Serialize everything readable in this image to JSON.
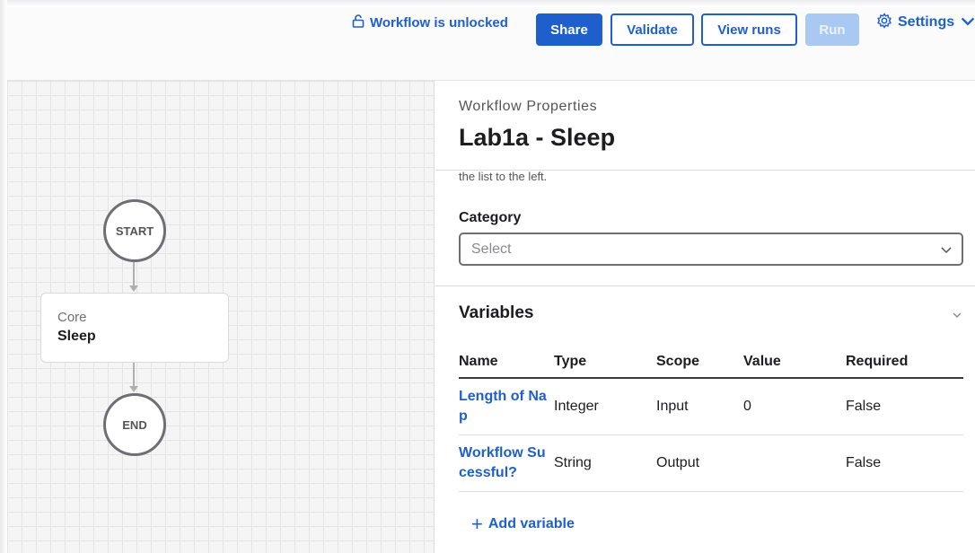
{
  "toolbar": {
    "lock_status": "Workflow is unlocked",
    "share_label": "Share",
    "validate_label": "Validate",
    "view_runs_label": "View runs",
    "run_label": "Run",
    "settings_label": "Settings",
    "icons": {
      "lock": "lock-open-icon",
      "settings": "gear-icon",
      "settings_dropdown": "chevron-down-icon"
    },
    "colors": {
      "accent": "#1f5fcc",
      "run_disabled": "#a9c8f2"
    }
  },
  "canvas": {
    "start_label": "START",
    "end_label": "END",
    "activity": {
      "category": "Core",
      "name": "Sleep"
    }
  },
  "panel": {
    "subtitle": "Workflow Properties",
    "title": "Lab1a - Sleep",
    "description_tail": "the list to the left.",
    "category_label": "Category",
    "category_placeholder": "Select",
    "variables_heading": "Variables",
    "variables": {
      "columns": [
        "Name",
        "Type",
        "Scope",
        "Value",
        "Required"
      ],
      "rows": [
        {
          "name": "Length of Nap",
          "type": "Integer",
          "scope": "Input",
          "value": "0",
          "required": "False"
        },
        {
          "name": "Workflow Sucessful?",
          "type": "String",
          "scope": "Output",
          "value": "",
          "required": "False"
        }
      ]
    },
    "add_variable_label": "Add variable"
  }
}
